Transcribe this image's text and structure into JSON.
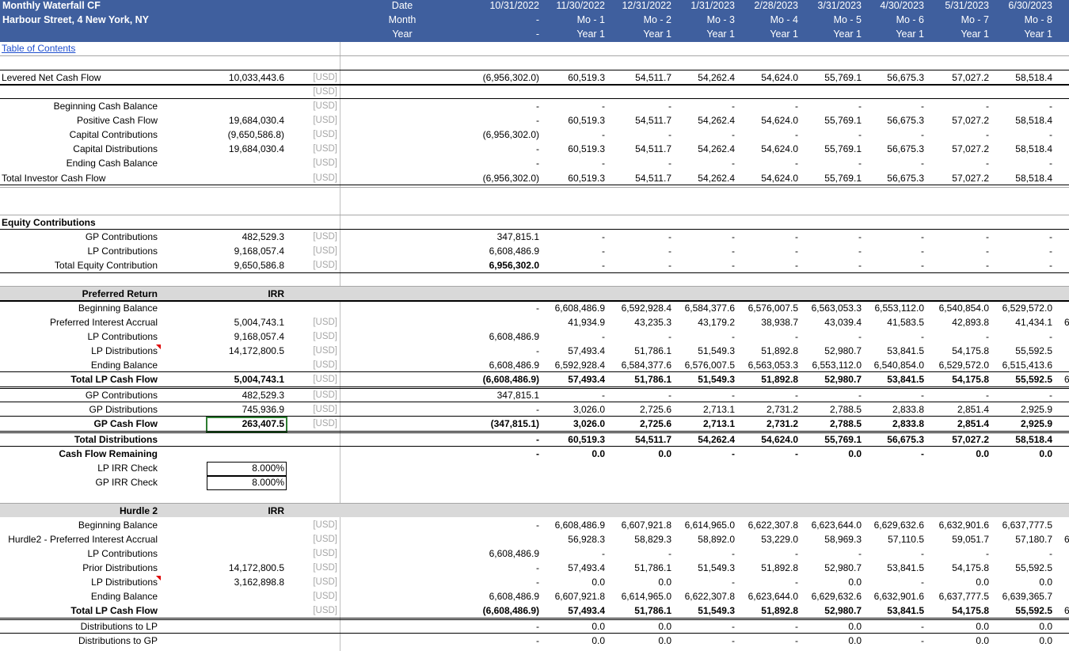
{
  "header": {
    "title": "Monthly Waterfall CF",
    "address": "Harbour Street, 4 New York, NY",
    "row_labels": [
      "Date",
      "Month",
      "Year"
    ],
    "columns": [
      {
        "date": "10/31/2022",
        "month": "-",
        "year": "-"
      },
      {
        "date": "11/30/2022",
        "month": "Mo - 1",
        "year": "Year 1"
      },
      {
        "date": "12/31/2022",
        "month": "Mo - 2",
        "year": "Year 1"
      },
      {
        "date": "1/31/2023",
        "month": "Mo - 3",
        "year": "Year 1"
      },
      {
        "date": "2/28/2023",
        "month": "Mo - 4",
        "year": "Year 1"
      },
      {
        "date": "3/31/2023",
        "month": "Mo - 5",
        "year": "Year 1"
      },
      {
        "date": "4/30/2023",
        "month": "Mo - 6",
        "year": "Year 1"
      },
      {
        "date": "5/31/2023",
        "month": "Mo - 7",
        "year": "Year 1"
      },
      {
        "date": "6/30/2023",
        "month": "Mo - 8",
        "year": "Year 1"
      }
    ]
  },
  "toc_link": "Table of Contents",
  "rows": [
    {
      "label": "Levered Net Cash Flow",
      "align": "left",
      "unit": "[USD]",
      "total": "10,033,443.6",
      "values": [
        "(6,956,302.0)",
        "60,519.3",
        "54,511.7",
        "54,262.4",
        "54,624.0",
        "55,769.1",
        "56,675.3",
        "57,027.2",
        "58,518.4"
      ]
    },
    {
      "label": "",
      "unit": "[USD]",
      "values": []
    },
    {
      "label": "Beginning Cash Balance",
      "unit": "[USD]",
      "values": [
        "-",
        "-",
        "-",
        "-",
        "-",
        "-",
        "-",
        "-",
        "-"
      ]
    },
    {
      "label": "Positive Cash Flow",
      "unit": "[USD]",
      "total": "19,684,030.4",
      "values": [
        "-",
        "60,519.3",
        "54,511.7",
        "54,262.4",
        "54,624.0",
        "55,769.1",
        "56,675.3",
        "57,027.2",
        "58,518.4"
      ]
    },
    {
      "label": "Capital Contributions",
      "unit": "[USD]",
      "total": "(9,650,586.8)",
      "values": [
        "(6,956,302.0)",
        "-",
        "-",
        "-",
        "-",
        "-",
        "-",
        "-",
        "-"
      ]
    },
    {
      "label": "Capital Distributions",
      "unit": "[USD]",
      "total": "19,684,030.4",
      "values": [
        "-",
        "60,519.3",
        "54,511.7",
        "54,262.4",
        "54,624.0",
        "55,769.1",
        "56,675.3",
        "57,027.2",
        "58,518.4"
      ]
    },
    {
      "label": "Ending Cash Balance",
      "unit": "[USD]",
      "values": [
        "-",
        "-",
        "-",
        "-",
        "-",
        "-",
        "-",
        "-",
        "-"
      ]
    },
    {
      "label": "Total Investor Cash Flow",
      "align": "left",
      "unit": "[USD]",
      "values": [
        "(6,956,302.0)",
        "60,519.3",
        "54,511.7",
        "54,262.4",
        "54,624.0",
        "55,769.1",
        "56,675.3",
        "57,027.2",
        "58,518.4"
      ]
    },
    {
      "label": "Equity Contributions",
      "align": "left",
      "bold": true
    },
    {
      "label": "GP Contributions",
      "unit": "[USD]",
      "total": "482,529.3",
      "values": [
        "347,815.1",
        "-",
        "-",
        "-",
        "-",
        "-",
        "-",
        "-",
        "-"
      ]
    },
    {
      "label": "LP Contributions",
      "unit": "[USD]",
      "total": "9,168,057.4",
      "values": [
        "6,608,486.9",
        "-",
        "-",
        "-",
        "-",
        "-",
        "-",
        "-",
        "-"
      ]
    },
    {
      "label": "Total Equity Contribution",
      "unit": "[USD]",
      "total": "9,650,586.8",
      "values": [
        "6,956,302.0",
        "-",
        "-",
        "-",
        "-",
        "-",
        "-",
        "-",
        "-"
      ],
      "boldfirst": true
    },
    {
      "label": "Preferred Return",
      "bold": true,
      "total": "IRR",
      "band": true
    },
    {
      "label": "Beginning Balance",
      "values": [
        "-",
        "6,608,486.9",
        "6,592,928.4",
        "6,584,377.6",
        "6,576,007.5",
        "6,563,053.3",
        "6,553,112.0",
        "6,540,854.0",
        "6,529,572.0"
      ]
    },
    {
      "label": "Preferred Interest Accrual",
      "unit": "[USD]",
      "total": "5,004,743.1",
      "values": [
        "",
        "41,934.9",
        "43,235.3",
        "43,179.2",
        "38,938.7",
        "43,039.4",
        "41,583.5",
        "42,893.8",
        "41,434.1"
      ]
    },
    {
      "label": "LP Contributions",
      "unit": "[USD]",
      "total": "9,168,057.4",
      "values": [
        "6,608,486.9",
        "-",
        "-",
        "-",
        "-",
        "-",
        "-",
        "-",
        "-"
      ]
    },
    {
      "label": "LP Distributions",
      "unit": "[USD]",
      "total": "14,172,800.5",
      "flag": true,
      "values": [
        "-",
        "57,493.4",
        "51,786.1",
        "51,549.3",
        "51,892.8",
        "52,980.7",
        "53,841.5",
        "54,175.8",
        "55,592.5"
      ]
    },
    {
      "label": "Ending Balance",
      "unit": "[USD]",
      "values": [
        "6,608,486.9",
        "6,592,928.4",
        "6,584,377.6",
        "6,576,007.5",
        "6,563,053.3",
        "6,553,112.0",
        "6,540,854.0",
        "6,529,572.0",
        "6,515,413.6"
      ]
    },
    {
      "label": "Total LP Cash Flow",
      "bold": true,
      "unit": "[USD]",
      "total": "5,004,743.1",
      "values": [
        "(6,608,486.9)",
        "57,493.4",
        "51,786.1",
        "51,549.3",
        "51,892.8",
        "52,980.7",
        "53,841.5",
        "54,175.8",
        "55,592.5"
      ]
    },
    {
      "label": "GP Contributions",
      "unit": "[USD]",
      "total": "482,529.3",
      "values": [
        "347,815.1",
        "-",
        "-",
        "-",
        "-",
        "-",
        "-",
        "-",
        "-"
      ]
    },
    {
      "label": "GP Distributions",
      "unit": "[USD]",
      "total": "745,936.9",
      "values": [
        "-",
        "3,026.0",
        "2,725.6",
        "2,713.1",
        "2,731.2",
        "2,788.5",
        "2,833.8",
        "2,851.4",
        "2,925.9"
      ]
    },
    {
      "label": "GP Cash Flow",
      "bold": true,
      "unit": "[USD]",
      "total": "263,407.5",
      "selected": true,
      "values": [
        "(347,815.1)",
        "3,026.0",
        "2,725.6",
        "2,713.1",
        "2,731.2",
        "2,788.5",
        "2,833.8",
        "2,851.4",
        "2,925.9"
      ]
    },
    {
      "label": "Total Distributions",
      "bold": true,
      "values": [
        "-",
        "60,519.3",
        "54,511.7",
        "54,262.4",
        "54,624.0",
        "55,769.1",
        "56,675.3",
        "57,027.2",
        "58,518.4"
      ]
    },
    {
      "label": "Cash Flow Remaining",
      "bold": true,
      "values": [
        "-",
        "0.0",
        "0.0",
        "-",
        "-",
        "0.0",
        "-",
        "0.0",
        "0.0"
      ]
    },
    {
      "label": "LP IRR Check",
      "total": "8.000%",
      "boxed": true
    },
    {
      "label": "GP IRR Check",
      "total": "8.000%",
      "boxed": true
    },
    {
      "label": "Hurdle 2",
      "bold": true,
      "total": "IRR",
      "band": true
    },
    {
      "label": "Beginning Balance",
      "unit": "[USD]",
      "values": [
        "-",
        "6,608,486.9",
        "6,607,921.8",
        "6,614,965.0",
        "6,622,307.8",
        "6,623,644.0",
        "6,629,632.6",
        "6,632,901.6",
        "6,637,777.5"
      ]
    },
    {
      "label": "Hurdle2 - Preferred Interest Accrual",
      "unit": "[USD]",
      "values": [
        "",
        "56,928.3",
        "58,829.3",
        "58,892.0",
        "53,229.0",
        "58,969.3",
        "57,110.5",
        "59,051.7",
        "57,180.7"
      ]
    },
    {
      "label": "LP Contributions",
      "unit": "[USD]",
      "values": [
        "6,608,486.9",
        "-",
        "-",
        "-",
        "-",
        "-",
        "-",
        "-",
        "-"
      ]
    },
    {
      "label": "Prior Distributions",
      "unit": "[USD]",
      "total": "14,172,800.5",
      "values": [
        "-",
        "57,493.4",
        "51,786.1",
        "51,549.3",
        "51,892.8",
        "52,980.7",
        "53,841.5",
        "54,175.8",
        "55,592.5"
      ]
    },
    {
      "label": "LP Distributions",
      "unit": "[USD]",
      "total": "3,162,898.8",
      "flag": true,
      "values": [
        "-",
        "0.0",
        "0.0",
        "-",
        "-",
        "0.0",
        "-",
        "0.0",
        "0.0"
      ]
    },
    {
      "label": "Ending Balance",
      "unit": "[USD]",
      "values": [
        "6,608,486.9",
        "6,607,921.8",
        "6,614,965.0",
        "6,622,307.8",
        "6,623,644.0",
        "6,629,632.6",
        "6,632,901.6",
        "6,637,777.5",
        "6,639,365.7"
      ]
    },
    {
      "label": "Total LP Cash Flow",
      "bold": true,
      "unit": "[USD]",
      "values": [
        "(6,608,486.9)",
        "57,493.4",
        "51,786.1",
        "51,549.3",
        "51,892.8",
        "52,980.7",
        "53,841.5",
        "54,175.8",
        "55,592.5"
      ]
    },
    {
      "label": "Distributions to LP",
      "values": [
        "-",
        "0.0",
        "0.0",
        "-",
        "-",
        "0.0",
        "-",
        "0.0",
        "0.0"
      ]
    },
    {
      "label": "Distributions to GP",
      "values": [
        "-",
        "0.0",
        "0.0",
        "-",
        "-",
        "0.0",
        "-",
        "0.0",
        "0.0"
      ]
    }
  ],
  "overflow_glyph": "6"
}
